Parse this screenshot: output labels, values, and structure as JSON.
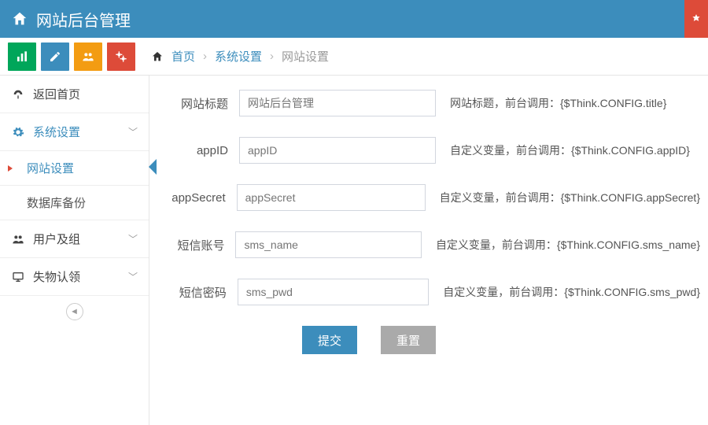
{
  "header": {
    "title": "网站后台管理"
  },
  "breadcrumb": {
    "home": "首页",
    "mid": "系统设置",
    "current": "网站设置"
  },
  "sidebar": {
    "return_home": "返回首页",
    "system_settings": "系统设置",
    "site_settings": "网站设置",
    "db_backup": "数据库备份",
    "users_groups": "用户及组",
    "lost_found": "失物认领"
  },
  "form": {
    "rows": [
      {
        "label": "网站标题",
        "placeholder": "网站后台管理",
        "hint": "网站标题，前台调用：{$Think.CONFIG.title}"
      },
      {
        "label": "appID",
        "placeholder": "appID",
        "hint": "自定义变量，前台调用：{$Think.CONFIG.appID}"
      },
      {
        "label": "appSecret",
        "placeholder": "appSecret",
        "hint": "自定义变量，前台调用：{$Think.CONFIG.appSecret}"
      },
      {
        "label": "短信账号",
        "placeholder": "sms_name",
        "hint": "自定义变量，前台调用：{$Think.CONFIG.sms_name}"
      },
      {
        "label": "短信密码",
        "placeholder": "sms_pwd",
        "hint": "自定义变量，前台调用：{$Think.CONFIG.sms_pwd}"
      }
    ],
    "submit": "提交",
    "reset": "重置"
  }
}
